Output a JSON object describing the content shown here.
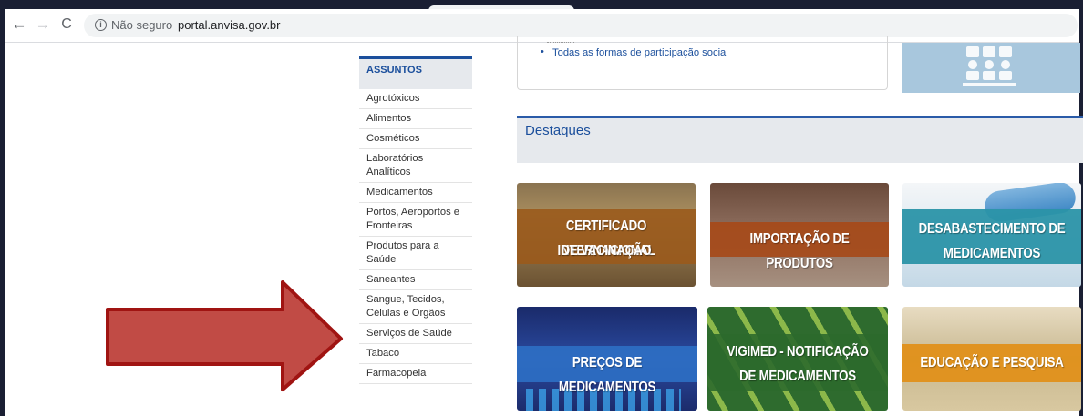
{
  "browser": {
    "security_label": "Não seguro",
    "url": "portal.anvisa.gov.br"
  },
  "sidebar": {
    "heading": "ASSUNTOS",
    "items": [
      {
        "label": "Agrotóxicos"
      },
      {
        "label": "Alimentos"
      },
      {
        "label": "Cosméticos"
      },
      {
        "label": "Laboratórios Analíticos"
      },
      {
        "label": "Medicamentos"
      },
      {
        "label": "Portos, Aeroportos e Fronteiras"
      },
      {
        "label": "Produtos para a Saúde"
      },
      {
        "label": "Saneantes"
      },
      {
        "label": "Sangue, Tecidos, Células e Orgãos"
      },
      {
        "label": "Serviços de Saúde"
      },
      {
        "label": "Tabaco"
      },
      {
        "label": "Farmacopeia"
      }
    ]
  },
  "participation": {
    "link": "Todas as formas de participação social"
  },
  "destaques": {
    "title": "Destaques",
    "tiles": [
      {
        "line1": "CERTIFICADO INTERNACIONAL",
        "line2": "DE VACINAÇÃO"
      },
      {
        "line1": "IMPORTAÇÃO DE PRODUTOS",
        "line2": ""
      },
      {
        "line1": "DESABASTECIMENTO DE",
        "line2": "MEDICAMENTOS"
      },
      {
        "line1": "PREÇOS DE MEDICAMENTOS",
        "line2": ""
      },
      {
        "line1": "VIGIMED - NOTIFICAÇÃO",
        "line2": "DE MEDICAMENTOS"
      },
      {
        "line1": "EDUCAÇÃO E PESQUISA",
        "line2": ""
      }
    ]
  },
  "annotation": {
    "arrow_color": "#c0392b",
    "arrow_points_to": "Serviços de Saúde"
  },
  "colors": {
    "brand_blue": "#1b4f9c",
    "header_bg": "#e6e9ed"
  }
}
